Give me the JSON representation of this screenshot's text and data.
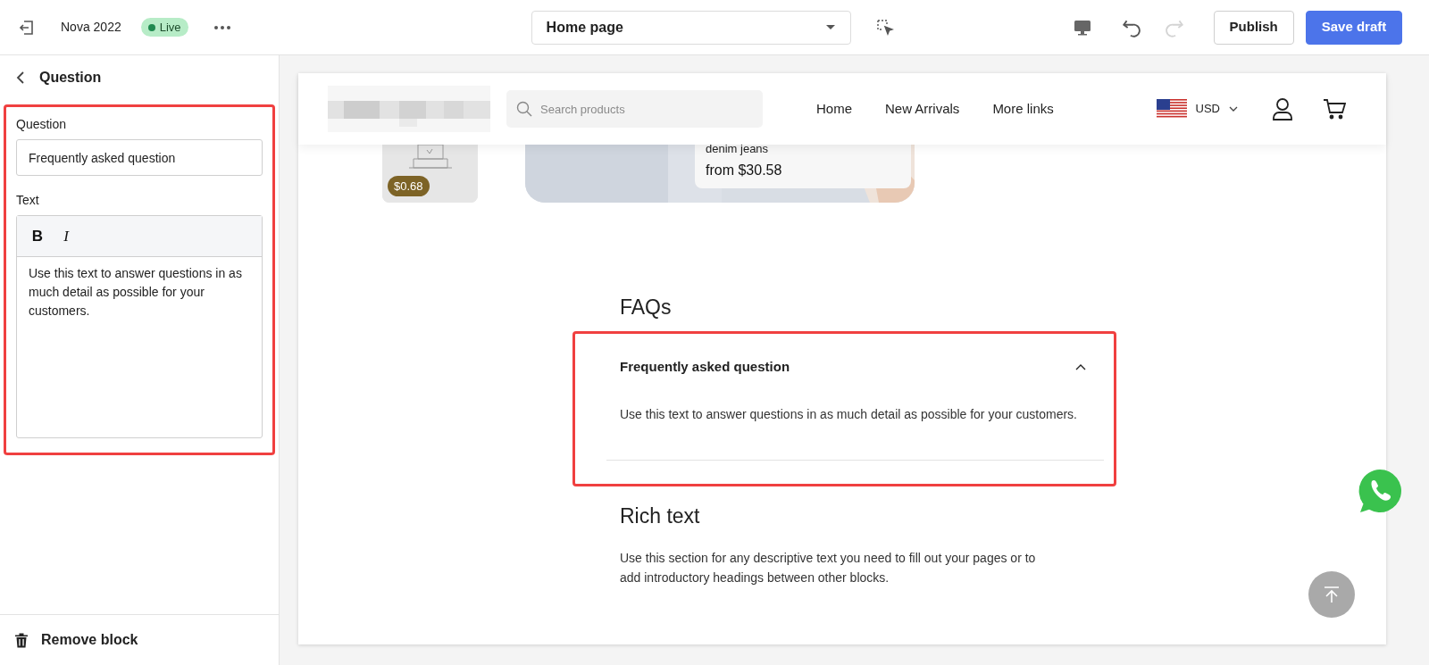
{
  "top_bar": {
    "site_name": "Nova 2022",
    "status": "Live",
    "page_select": "Home page",
    "history": [
      {
        "kind": "undo",
        "disabled": false
      },
      {
        "kind": "redo",
        "disabled": true
      }
    ],
    "buttons": [
      {
        "label": "Publish",
        "kind": "secondary"
      },
      {
        "label": "Save draft",
        "kind": "primary"
      }
    ]
  },
  "panel": {
    "title": "Question",
    "highlighted": true,
    "fields": [
      {
        "kind": "input",
        "label": "Question",
        "value": "Frequently asked question"
      },
      {
        "kind": "richtext",
        "label": "Text",
        "format_buttons": [
          {
            "label": "B",
            "kind": "bold"
          },
          {
            "label": "I",
            "kind": "italic"
          }
        ],
        "value": "Use this text to answer questions in as much detail as possible for your customers."
      }
    ],
    "remove_button": "Remove block"
  },
  "preview": {
    "search_placeholder": "Search products",
    "nav_links": [
      "Home",
      "New Arrivals",
      "More links"
    ],
    "currency": "USD",
    "products": [
      {
        "kind": "price",
        "price": "$0.68"
      },
      {
        "kind": "collection",
        "lines": [
          "denim jeans",
          "from $30.58"
        ]
      }
    ],
    "faq": {
      "heading": "FAQs",
      "highlighted": true,
      "items": [
        {
          "question": "Frequently asked question",
          "answer": "Use this text to answer questions in as much detail as possible for your customers.",
          "expanded": true
        }
      ]
    },
    "rich_text": {
      "heading": "Rich text",
      "body": "Use this section for any descriptive text you need to fill out your pages or to add introductory headings between other blocks."
    }
  }
}
